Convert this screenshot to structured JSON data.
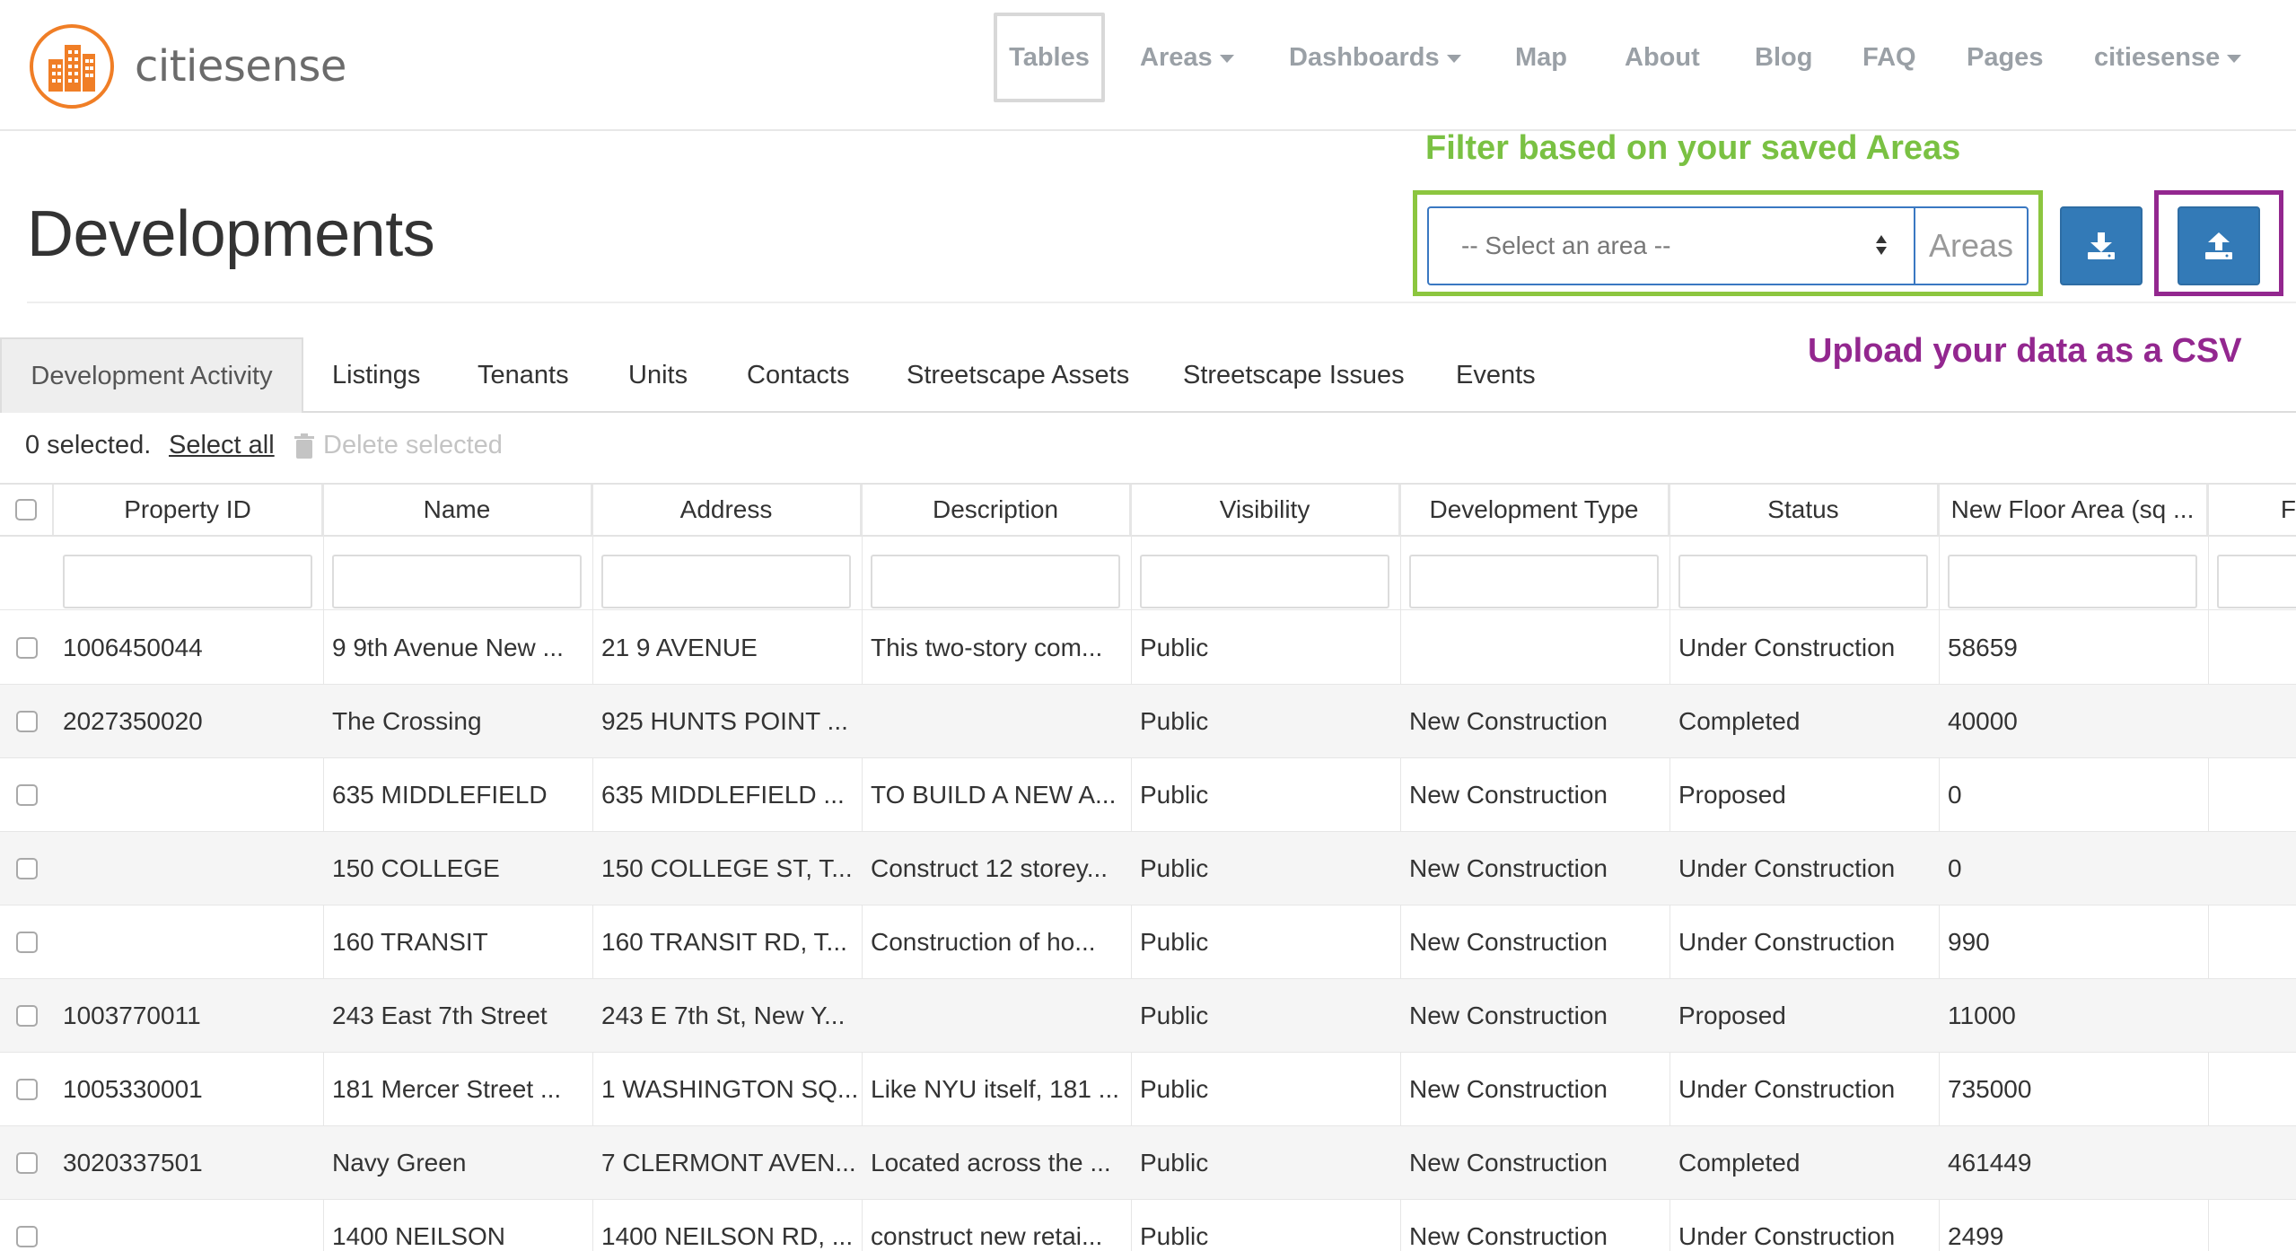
{
  "brand": {
    "name": "citiesense",
    "accent_color": "#f07e26"
  },
  "nav": {
    "items": [
      {
        "label": "Tables",
        "active": true,
        "dropdown": false
      },
      {
        "label": "Areas",
        "active": false,
        "dropdown": true
      },
      {
        "label": "Dashboards",
        "active": false,
        "dropdown": true
      },
      {
        "label": "Map",
        "active": false,
        "dropdown": false
      },
      {
        "label": "About",
        "active": false,
        "dropdown": false
      },
      {
        "label": "Blog",
        "active": false,
        "dropdown": false
      },
      {
        "label": "FAQ",
        "active": false,
        "dropdown": false
      },
      {
        "label": "Pages",
        "active": false,
        "dropdown": false
      },
      {
        "label": "citiesense",
        "active": false,
        "dropdown": true
      }
    ]
  },
  "annotations": {
    "filter_hint": "Filter based on your saved Areas",
    "filter_color": "#8cc63f",
    "upload_hint": "Upload your data as a CSV",
    "upload_color": "#93278f"
  },
  "header": {
    "title": "Developments",
    "area_select_value": "-- Select an area --",
    "area_addon": "Areas",
    "download_icon": "download-icon",
    "upload_icon": "upload-icon",
    "button_color": "#337ab7"
  },
  "tabs": [
    {
      "label": "Development Activity",
      "active": true
    },
    {
      "label": "Listings",
      "active": false
    },
    {
      "label": "Tenants",
      "active": false
    },
    {
      "label": "Units",
      "active": false
    },
    {
      "label": "Contacts",
      "active": false
    },
    {
      "label": "Streetscape Assets",
      "active": false
    },
    {
      "label": "Streetscape Issues",
      "active": false
    },
    {
      "label": "Events",
      "active": false
    }
  ],
  "toolbar": {
    "selected_count": "0 selected.",
    "select_all": "Select all",
    "delete_selected": "Delete selected"
  },
  "table": {
    "columns": [
      "Property ID",
      "Name",
      "Address",
      "Description",
      "Visibility",
      "Development Type",
      "Status",
      "New Floor Area (sq ...",
      "F"
    ],
    "rows": [
      [
        "1006450044",
        "9 9th Avenue New ...",
        "21 9 AVENUE",
        "This two-story com...",
        "Public",
        "",
        "Under Construction",
        "58659"
      ],
      [
        "2027350020",
        "The Crossing",
        "925 HUNTS POINT ...",
        "",
        "Public",
        "New Construction",
        "Completed",
        "40000"
      ],
      [
        "",
        "635 MIDDLEFIELD",
        "635 MIDDLEFIELD ...",
        "TO BUILD A NEW A...",
        "Public",
        "New Construction",
        "Proposed",
        "0"
      ],
      [
        "",
        "150 COLLEGE",
        "150 COLLEGE ST, T...",
        "Construct 12 storey...",
        "Public",
        "New Construction",
        "Under Construction",
        "0"
      ],
      [
        "",
        "160 TRANSIT",
        "160 TRANSIT RD, T...",
        "Construction of ho...",
        "Public",
        "New Construction",
        "Under Construction",
        "990"
      ],
      [
        "1003770011",
        "243 East 7th Street",
        "243 E 7th St, New Y...",
        "",
        "Public",
        "New Construction",
        "Proposed",
        "11000"
      ],
      [
        "1005330001",
        "181 Mercer Street ...",
        "1 WASHINGTON SQ...",
        "Like NYU itself, 181 ...",
        "Public",
        "New Construction",
        "Under Construction",
        "735000"
      ],
      [
        "3020337501",
        "Navy Green",
        "7 CLERMONT AVEN...",
        "Located across the ...",
        "Public",
        "New Construction",
        "Completed",
        "461449"
      ],
      [
        "",
        "1400 NEILSON",
        "1400 NEILSON RD, ...",
        "construct new retai...",
        "Public",
        "New Construction",
        "Under Construction",
        "2499"
      ]
    ]
  }
}
